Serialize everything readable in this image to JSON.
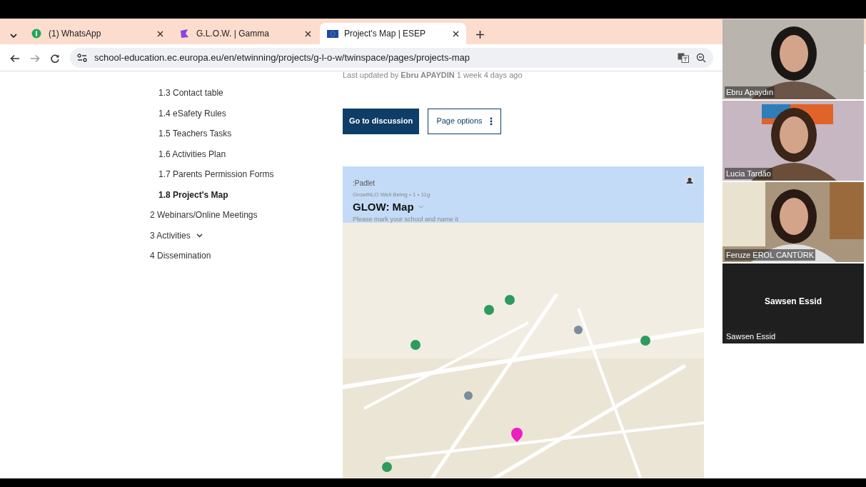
{
  "tabs": [
    {
      "title": "(1) WhatsApp",
      "kind": "whatsapp",
      "selected": false
    },
    {
      "title": "G.L.O.W. | Gamma",
      "kind": "gamma",
      "selected": false
    },
    {
      "title": "Project's Map | ESEP",
      "kind": "eu",
      "selected": true
    }
  ],
  "address": {
    "url": "school-education.ec.europa.eu/en/etwinning/projects/g-l-o-w/twinspace/pages/projects-map"
  },
  "sidebar": {
    "items": [
      {
        "label": "1.3 Contact table",
        "selected": false
      },
      {
        "label": "1.4 eSafety Rules",
        "selected": false
      },
      {
        "label": "1.5 Teachers Tasks",
        "selected": false
      },
      {
        "label": "1.6 Activities Plan",
        "selected": false
      },
      {
        "label": "1.7 Parents Permission Forms",
        "selected": false
      },
      {
        "label": "1.8 Project's Map",
        "selected": true
      },
      {
        "label": "2 Webinars/Online Meetings",
        "selected": false
      },
      {
        "label": "3 Activities",
        "selected": false,
        "expandable": true
      },
      {
        "label": "4 Dissemination",
        "selected": false
      }
    ]
  },
  "page": {
    "last_updated": "Last updated by **Ebru APAYDIN** 1 week 4 days ago",
    "buttons": [
      {
        "label": "Go to discussion",
        "kind": "primary"
      },
      {
        "label": "Page options",
        "kind": "outline"
      }
    ],
    "padlet": {
      "brand": ":Padlet",
      "meta": "GrowthLO Well Being • 1 • 11g",
      "title": "GLOW: Map",
      "subtitle": "Please mark your school and name it"
    }
  },
  "participants": [
    {
      "name": "Ebru Apaydın",
      "kind": "video"
    },
    {
      "name": "Lucia Tardão",
      "kind": "video"
    },
    {
      "name": "Feruze EROL CANTÜRK",
      "kind": "video"
    },
    {
      "name": "Sawsen Essid",
      "kind": "avatar",
      "display": "Sawsen Essid"
    }
  ]
}
